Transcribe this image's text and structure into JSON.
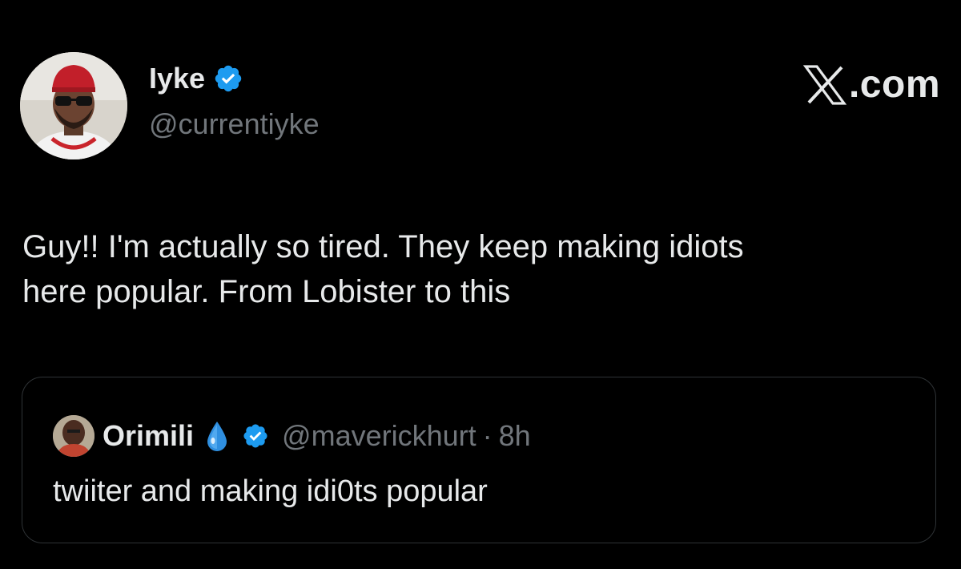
{
  "tweet": {
    "author": {
      "display_name": "Iyke",
      "handle": "@currentiyke",
      "verified": true,
      "avatar_icon": "profile-photo"
    },
    "brand_label": ".com",
    "brand_icon": "x-logo-icon",
    "text": "Guy!! I'm actually so tired. They keep making idiots\nhere popular. From Lobister to this",
    "quoted": {
      "display_name": "Orimili",
      "emoji": "💧",
      "verified": true,
      "handle": "@maverickhurt",
      "separator": "·",
      "time": "8h",
      "text": "twiiter and making idi0ts popular"
    }
  },
  "colors": {
    "background": "#000000",
    "primary_text": "#e7e9ea",
    "secondary_text": "#71767b",
    "verified_blue": "#1d9bf0",
    "border": "#2f3336"
  }
}
